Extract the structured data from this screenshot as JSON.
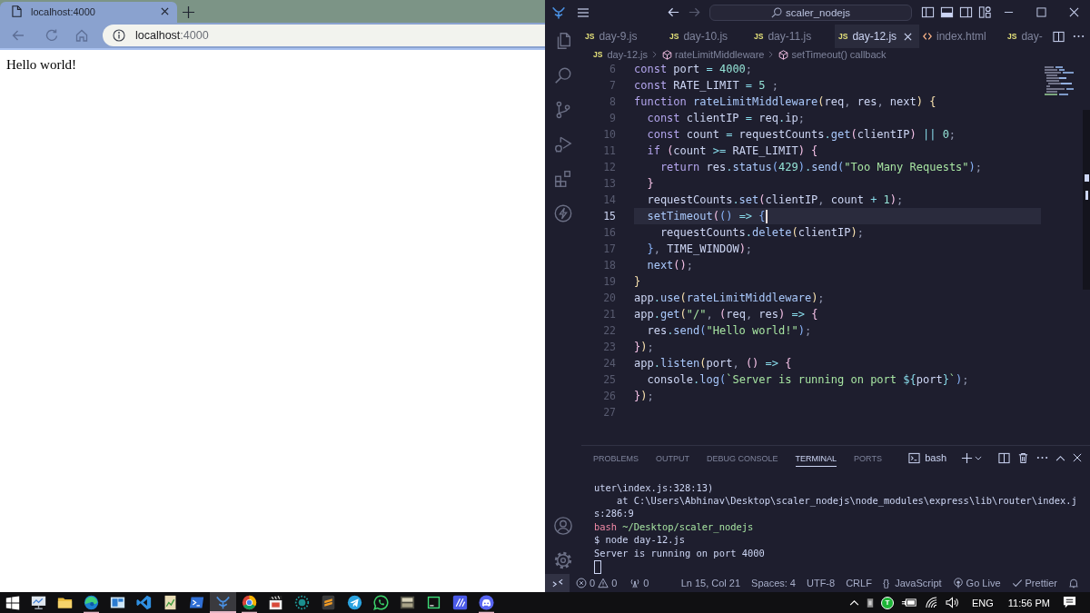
{
  "browser": {
    "tab_title": "localhost:4000",
    "address": {
      "host": "localhost",
      "rest": ":4000"
    },
    "page_text": "Hello world!"
  },
  "editor": {
    "search": "scaler_nodejs",
    "history_buttons": [
      {
        "kind": "back",
        "disabled": false
      },
      {
        "kind": "forward",
        "disabled": true
      }
    ],
    "layout_toggles": [
      {
        "kind": "sidebar",
        "on": false
      },
      {
        "kind": "panel",
        "on": true
      },
      {
        "kind": "secondary",
        "on": false
      }
    ],
    "tabs": [
      {
        "kind": "js",
        "badge": "JS",
        "label": "day-9.js",
        "selected": false
      },
      {
        "kind": "js",
        "badge": "JS",
        "label": "day-10.js",
        "selected": false
      },
      {
        "kind": "js",
        "badge": "JS",
        "label": "day-11.js",
        "selected": false
      },
      {
        "kind": "js",
        "badge": "JS",
        "label": "day-12.js",
        "selected": true
      },
      {
        "kind": "html",
        "label": "index.html",
        "selected": false
      },
      {
        "kind": "js",
        "badge": "JS",
        "label": "day-",
        "selected": false
      }
    ],
    "breadcrumb": [
      {
        "kind": "file",
        "badge": "JS",
        "label": "day-12.js"
      },
      {
        "kind": "symbol",
        "label": "rateLimitMiddleware"
      },
      {
        "kind": "symbol",
        "label": "setTimeout() callback"
      }
    ],
    "code_lines": [
      {
        "number": "6",
        "current": false,
        "tokens": [
          {
            "kind": "kw",
            "text": "const "
          },
          {
            "kind": "id",
            "text": "port "
          },
          {
            "kind": "op",
            "text": "= "
          },
          {
            "kind": "num",
            "text": "4000"
          },
          {
            "kind": "pn",
            "text": ";"
          }
        ]
      },
      {
        "number": "7",
        "current": false,
        "tokens": [
          {
            "kind": "kw",
            "text": "const "
          },
          {
            "kind": "id",
            "text": "RATE_LIMIT "
          },
          {
            "kind": "op",
            "text": "= "
          },
          {
            "kind": "num",
            "text": "5 "
          },
          {
            "kind": "pn",
            "text": ";"
          }
        ]
      },
      {
        "number": "8",
        "current": false,
        "tokens": [
          {
            "kind": "kw",
            "text": "function "
          },
          {
            "kind": "fn",
            "text": "rateLimitMiddleware"
          },
          {
            "kind": "b1",
            "text": "("
          },
          {
            "kind": "id",
            "text": "req"
          },
          {
            "kind": "pn",
            "text": ", "
          },
          {
            "kind": "id",
            "text": "res"
          },
          {
            "kind": "pn",
            "text": ", "
          },
          {
            "kind": "id",
            "text": "next"
          },
          {
            "kind": "b1",
            "text": ") {"
          }
        ]
      },
      {
        "number": "9",
        "current": false,
        "tokens": [
          {
            "kind": "kw",
            "text": "  const "
          },
          {
            "kind": "id",
            "text": "clientIP "
          },
          {
            "kind": "op",
            "text": "= "
          },
          {
            "kind": "id",
            "text": "req"
          },
          {
            "kind": "op",
            "text": "."
          },
          {
            "kind": "id",
            "text": "ip"
          },
          {
            "kind": "pn",
            "text": ";"
          }
        ]
      },
      {
        "number": "10",
        "current": false,
        "tokens": [
          {
            "kind": "kw",
            "text": "  const "
          },
          {
            "kind": "id",
            "text": "count "
          },
          {
            "kind": "op",
            "text": "= "
          },
          {
            "kind": "id",
            "text": "requestCounts"
          },
          {
            "kind": "op",
            "text": "."
          },
          {
            "kind": "fn",
            "text": "get"
          },
          {
            "kind": "b2",
            "text": "("
          },
          {
            "kind": "id",
            "text": "clientIP"
          },
          {
            "kind": "b2",
            "text": ")"
          },
          {
            "kind": "op",
            "text": " || "
          },
          {
            "kind": "num",
            "text": "0"
          },
          {
            "kind": "pn",
            "text": ";"
          }
        ]
      },
      {
        "number": "11",
        "current": false,
        "tokens": [
          {
            "kind": "kw",
            "text": "  if "
          },
          {
            "kind": "b2",
            "text": "("
          },
          {
            "kind": "id",
            "text": "count "
          },
          {
            "kind": "op",
            "text": ">= "
          },
          {
            "kind": "id",
            "text": "RATE_LIMIT"
          },
          {
            "kind": "b2",
            "text": ") {"
          }
        ]
      },
      {
        "number": "12",
        "current": false,
        "tokens": [
          {
            "kind": "kw",
            "text": "    return "
          },
          {
            "kind": "id",
            "text": "res"
          },
          {
            "kind": "op",
            "text": "."
          },
          {
            "kind": "fn",
            "text": "status"
          },
          {
            "kind": "b3",
            "text": "("
          },
          {
            "kind": "num",
            "text": "429"
          },
          {
            "kind": "b3",
            "text": ")"
          },
          {
            "kind": "op",
            "text": "."
          },
          {
            "kind": "fn",
            "text": "send"
          },
          {
            "kind": "b3",
            "text": "("
          },
          {
            "kind": "str",
            "text": "\"Too Many Requests\""
          },
          {
            "kind": "b3",
            "text": ")"
          },
          {
            "kind": "pn",
            "text": ";"
          }
        ]
      },
      {
        "number": "13",
        "current": false,
        "tokens": [
          {
            "kind": "b2",
            "text": "  }"
          }
        ]
      },
      {
        "number": "14",
        "current": false,
        "tokens": [
          {
            "kind": "id",
            "text": "  requestCounts"
          },
          {
            "kind": "op",
            "text": "."
          },
          {
            "kind": "fn",
            "text": "set"
          },
          {
            "kind": "b2",
            "text": "("
          },
          {
            "kind": "id",
            "text": "clientIP"
          },
          {
            "kind": "pn",
            "text": ", "
          },
          {
            "kind": "id",
            "text": "count "
          },
          {
            "kind": "op",
            "text": "+ "
          },
          {
            "kind": "num",
            "text": "1"
          },
          {
            "kind": "b2",
            "text": ")"
          },
          {
            "kind": "pn",
            "text": ";"
          }
        ]
      },
      {
        "number": "15",
        "current": true,
        "tokens": [
          {
            "kind": "fn",
            "text": "  setTimeout"
          },
          {
            "kind": "b2",
            "text": "("
          },
          {
            "kind": "b3",
            "text": "() "
          },
          {
            "kind": "op",
            "text": "=> "
          },
          {
            "kind": "b3",
            "text": "{"
          }
        ]
      },
      {
        "number": "16",
        "current": false,
        "tokens": [
          {
            "kind": "id",
            "text": "    requestCounts"
          },
          {
            "kind": "op",
            "text": "."
          },
          {
            "kind": "fn",
            "text": "delete"
          },
          {
            "kind": "b1",
            "text": "("
          },
          {
            "kind": "id",
            "text": "clientIP"
          },
          {
            "kind": "b1",
            "text": ")"
          },
          {
            "kind": "pn",
            "text": ";"
          }
        ]
      },
      {
        "number": "17",
        "current": false,
        "tokens": [
          {
            "kind": "b3",
            "text": "  }"
          },
          {
            "kind": "pn",
            "text": ", "
          },
          {
            "kind": "id",
            "text": "TIME_WINDOW"
          },
          {
            "kind": "b2",
            "text": ")"
          },
          {
            "kind": "pn",
            "text": ";"
          }
        ]
      },
      {
        "number": "18",
        "current": false,
        "tokens": [
          {
            "kind": "fn",
            "text": "  next"
          },
          {
            "kind": "b2",
            "text": "()"
          },
          {
            "kind": "pn",
            "text": ";"
          }
        ]
      },
      {
        "number": "19",
        "current": false,
        "tokens": [
          {
            "kind": "b1",
            "text": "}"
          }
        ]
      },
      {
        "number": "20",
        "current": false,
        "tokens": [
          {
            "kind": "id",
            "text": "app"
          },
          {
            "kind": "op",
            "text": "."
          },
          {
            "kind": "fn",
            "text": "use"
          },
          {
            "kind": "b1",
            "text": "("
          },
          {
            "kind": "fn",
            "text": "rateLimitMiddleware"
          },
          {
            "kind": "b1",
            "text": ")"
          },
          {
            "kind": "pn",
            "text": ";"
          }
        ]
      },
      {
        "number": "21",
        "current": false,
        "tokens": [
          {
            "kind": "id",
            "text": "app"
          },
          {
            "kind": "op",
            "text": "."
          },
          {
            "kind": "fn",
            "text": "get"
          },
          {
            "kind": "b1",
            "text": "("
          },
          {
            "kind": "str",
            "text": "\"/\""
          },
          {
            "kind": "pn",
            "text": ", "
          },
          {
            "kind": "b2",
            "text": "("
          },
          {
            "kind": "id",
            "text": "req"
          },
          {
            "kind": "pn",
            "text": ", "
          },
          {
            "kind": "id",
            "text": "res"
          },
          {
            "kind": "b2",
            "text": ") "
          },
          {
            "kind": "op",
            "text": "=> "
          },
          {
            "kind": "b2",
            "text": "{"
          }
        ]
      },
      {
        "number": "22",
        "current": false,
        "tokens": [
          {
            "kind": "id",
            "text": "  res"
          },
          {
            "kind": "op",
            "text": "."
          },
          {
            "kind": "fn",
            "text": "send"
          },
          {
            "kind": "b3",
            "text": "("
          },
          {
            "kind": "str",
            "text": "\"Hello world!\""
          },
          {
            "kind": "b3",
            "text": ")"
          },
          {
            "kind": "pn",
            "text": ";"
          }
        ]
      },
      {
        "number": "23",
        "current": false,
        "tokens": [
          {
            "kind": "b2",
            "text": "}"
          },
          {
            "kind": "b1",
            "text": ")"
          },
          {
            "kind": "pn",
            "text": ";"
          }
        ]
      },
      {
        "number": "24",
        "current": false,
        "tokens": [
          {
            "kind": "id",
            "text": "app"
          },
          {
            "kind": "op",
            "text": "."
          },
          {
            "kind": "fn",
            "text": "listen"
          },
          {
            "kind": "b1",
            "text": "("
          },
          {
            "kind": "id",
            "text": "port"
          },
          {
            "kind": "pn",
            "text": ", "
          },
          {
            "kind": "b2",
            "text": "() "
          },
          {
            "kind": "op",
            "text": "=> "
          },
          {
            "kind": "b2",
            "text": "{"
          }
        ]
      },
      {
        "number": "25",
        "current": false,
        "tokens": [
          {
            "kind": "id",
            "text": "  console"
          },
          {
            "kind": "op",
            "text": "."
          },
          {
            "kind": "fn",
            "text": "log"
          },
          {
            "kind": "b3",
            "text": "("
          },
          {
            "kind": "str",
            "text": "`Server is running on port "
          },
          {
            "kind": "op",
            "text": "${"
          },
          {
            "kind": "id",
            "text": "port"
          },
          {
            "kind": "op",
            "text": "}"
          },
          {
            "kind": "str",
            "text": "`"
          },
          {
            "kind": "b3",
            "text": ")"
          },
          {
            "kind": "pn",
            "text": ";"
          }
        ]
      },
      {
        "number": "26",
        "current": false,
        "tokens": [
          {
            "kind": "b2",
            "text": "}"
          },
          {
            "kind": "b1",
            "text": ")"
          },
          {
            "kind": "pn",
            "text": ";"
          }
        ]
      },
      {
        "number": "27",
        "current": false
      }
    ],
    "panel": {
      "tabs": [
        {
          "label": "PROBLEMS",
          "selected": false
        },
        {
          "label": "OUTPUT",
          "selected": false
        },
        {
          "label": "DEBUG CONSOLE",
          "selected": false
        },
        {
          "label": "TERMINAL",
          "selected": true
        },
        {
          "label": "PORTS",
          "selected": false
        }
      ],
      "shell": "bash",
      "terminal_lines": [
        {
          "kind": "text",
          "text": "uter\\index.js:328:13)"
        },
        {
          "kind": "text",
          "text": "    at C:\\Users\\Abhinav\\Desktop\\scaler_nodejs\\node_modules\\express\\lib\\router\\index.j"
        },
        {
          "kind": "text",
          "text": "s:286:9"
        },
        {
          "kind": "prompt",
          "shell": "bash",
          "path": "~/Desktop/scaler_nodejs"
        },
        {
          "kind": "text",
          "text": "$ node day-12.js"
        },
        {
          "kind": "text",
          "text": "Server is running on port 4000"
        }
      ]
    },
    "status_bar": {
      "errors": "0",
      "warnings": "0",
      "ports": "0",
      "position": "Ln 15, Col 21",
      "indentation": "Spaces: 4",
      "encoding": "UTF-8",
      "line_endings": "CRLF",
      "language_icon": "{}",
      "language": "JavaScript",
      "live_server": "Go Live",
      "formatter": "Prettier"
    }
  },
  "taskbar": {
    "apps": [
      {
        "kind": "monitor",
        "running": false,
        "active": false
      },
      {
        "kind": "folder",
        "running": false,
        "active": false
      },
      {
        "kind": "swirl",
        "running": true,
        "active": false
      },
      {
        "kind": "window",
        "running": false,
        "active": false
      },
      {
        "kind": "ribbon",
        "running": false,
        "active": false
      },
      {
        "kind": "note",
        "running": false,
        "active": false
      },
      {
        "kind": "prompt",
        "running": false,
        "active": false
      },
      {
        "kind": "branch",
        "running": true,
        "active": true
      },
      {
        "kind": "ring",
        "running": true,
        "active": false
      },
      {
        "kind": "clapper",
        "running": false,
        "active": false
      },
      {
        "kind": "dotted",
        "running": false,
        "active": false
      },
      {
        "kind": "bars",
        "running": false,
        "active": false
      },
      {
        "kind": "plane",
        "running": false,
        "active": false
      },
      {
        "kind": "phone",
        "running": false,
        "active": false
      },
      {
        "kind": "image",
        "running": false,
        "active": false
      },
      {
        "kind": "frame",
        "running": false,
        "active": false
      },
      {
        "kind": "stripes",
        "running": false,
        "active": false
      },
      {
        "kind": "controller",
        "running": true,
        "active": false
      }
    ],
    "tray": {
      "badge": "T",
      "language": "ENG",
      "time": "11:56 PM"
    }
  }
}
